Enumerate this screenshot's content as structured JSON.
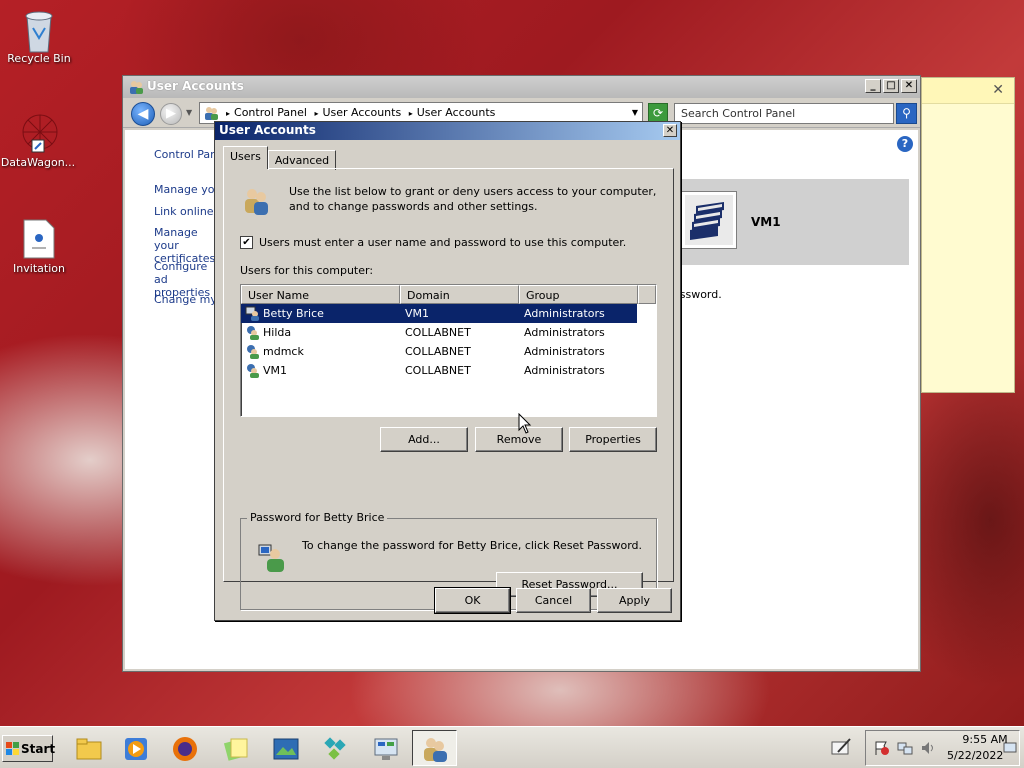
{
  "desktop": {
    "icons": [
      {
        "label": "Recycle Bin",
        "icon": "recycle-bin-icon"
      },
      {
        "label": "DataWagon...",
        "icon": "datawagon-shortcut-icon"
      },
      {
        "label": "Invitation",
        "icon": "document-icon"
      }
    ]
  },
  "control_panel": {
    "title": "User Accounts",
    "breadcrumb": [
      "Control Panel",
      "User Accounts",
      "User Accounts"
    ],
    "search_placeholder": "Search Control Panel",
    "sidebar_links": [
      "Control Pane",
      "Manage your",
      "Link online ID",
      "Manage your certificates",
      "Configure ad properties",
      "Change my e"
    ],
    "account_name": "VM1",
    "partial_text": "assword."
  },
  "dialog": {
    "title": "User Accounts",
    "tabs": [
      "Users",
      "Advanced"
    ],
    "intro": "Use the list below to grant or deny users access to your computer, and to change passwords and other settings.",
    "checkbox_label": "Users must enter a user name and password to use this computer.",
    "checkbox_checked": true,
    "list_label": "Users for this computer:",
    "columns": [
      "User Name",
      "Domain",
      "Group"
    ],
    "users": [
      {
        "name": "Betty Brice",
        "domain": "VM1",
        "group": "Administrators",
        "selected": true
      },
      {
        "name": "Hilda",
        "domain": "COLLABNET",
        "group": "Administrators"
      },
      {
        "name": "mdmck",
        "domain": "COLLABNET",
        "group": "Administrators"
      },
      {
        "name": "VM1",
        "domain": "COLLABNET",
        "group": "Administrators"
      }
    ],
    "buttons": {
      "add": "Add...",
      "remove": "Remove",
      "properties": "Properties"
    },
    "password_group_label": "Password for Betty Brice",
    "password_msg": "To change the password for Betty Brice, click Reset Password.",
    "reset_button": "Reset Password...",
    "footer": {
      "ok": "OK",
      "cancel": "Cancel",
      "apply": "Apply"
    }
  },
  "taskbar": {
    "start_label": "Start",
    "time": "9:55 AM",
    "date": "5/22/2022"
  },
  "colors": {
    "selection": "#0a246a",
    "title_start": "#0a246a",
    "title_end": "#a6caf0",
    "desktop": "#b52026"
  }
}
